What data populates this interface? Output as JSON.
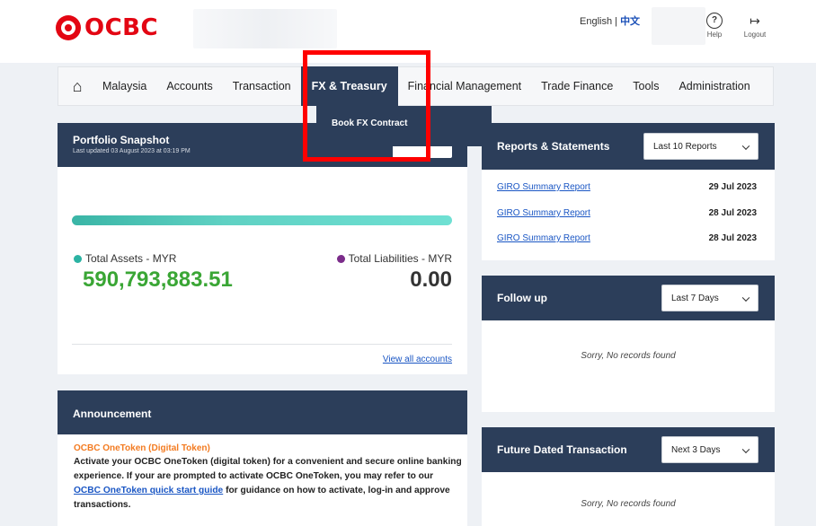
{
  "brand": {
    "logo_text": "OCBC"
  },
  "header": {
    "lang_en": "English",
    "lang_sep": "|",
    "lang_zh": "中文",
    "help_label": "Help",
    "logout_label": "Logout",
    "help_icon": "question-circle-icon",
    "logout_icon": "logout-arrow-icon"
  },
  "nav": {
    "home_icon": "home-icon",
    "items": [
      "Malaysia",
      "Accounts",
      "Transaction",
      "FX & Treasury",
      "Financial Management",
      "Trade Finance",
      "Tools",
      "Administration"
    ],
    "active_index": 3,
    "dropdown_items": [
      "Book FX Contract"
    ]
  },
  "portfolio": {
    "title": "Portfolio Snapshot",
    "updated": "Last updated 03 August 2023 at 03:19 PM",
    "assets_label": "Total Assets - MYR",
    "assets_value": "590,793,883.51",
    "liabilities_label": "Total Liabilities - MYR",
    "liabilities_value": "0.00",
    "view_all": "View all accounts",
    "assets_color": "#3aa635",
    "assets_dot": "#2bb3a3",
    "liabilities_dot": "#7b2c8a"
  },
  "reports": {
    "title": "Reports & Statements",
    "filter": "Last 10 Reports",
    "rows": [
      {
        "name": "GIRO Summary Report",
        "date": "29 Jul 2023"
      },
      {
        "name": "GIRO Summary Report",
        "date": "28 Jul 2023"
      },
      {
        "name": "GIRO Summary Report",
        "date": "28 Jul 2023"
      }
    ]
  },
  "followup": {
    "title": "Follow up",
    "filter": "Last 7 Days",
    "empty": "Sorry, No records found"
  },
  "future": {
    "title": "Future Dated Transaction",
    "filter": "Next 3 Days",
    "empty": "Sorry, No records found"
  },
  "announcement": {
    "title": "Announcement",
    "item_title": "OCBC OneToken (Digital Token)",
    "body_before": "Activate your OCBC OneToken (digital token) for a convenient and secure online banking experience. If your are prompted to activate OCBC OneToken, you may refer to our ",
    "link_text": "OCBC OneToken quick start guide",
    "body_after": " for guidance on how to activate, log-in and approve transactions."
  }
}
